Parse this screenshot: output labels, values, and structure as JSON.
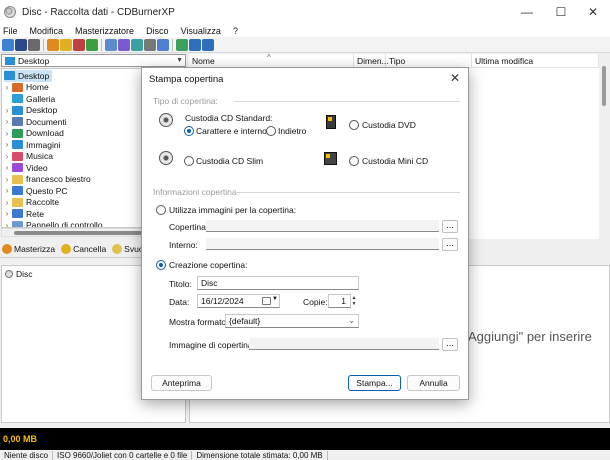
{
  "window": {
    "title": "Disc - Raccolta dati - CDBurnerXP"
  },
  "menu": [
    "File",
    "Modifica",
    "Masterizzatore",
    "Disco",
    "Visualizza",
    "?"
  ],
  "toolbar_icons": [
    {
      "name": "new-icon",
      "color": "#3d7fd0"
    },
    {
      "name": "save-icon",
      "color": "#2b4a8c"
    },
    {
      "name": "print-icon",
      "color": "#6a6a6a"
    },
    {
      "name": "burn-icon",
      "color": "#e08a1e"
    },
    {
      "name": "erase-icon",
      "color": "#e0b01e"
    },
    {
      "name": "disc-icon",
      "color": "#c04040"
    },
    {
      "name": "refresh-icon",
      "color": "#3ca040"
    },
    {
      "name": "cd-drive-icon",
      "color": "#5a8ad0"
    },
    {
      "name": "dvd-drive-icon",
      "color": "#7a5ad0"
    },
    {
      "name": "audio-icon",
      "color": "#3ca0a0"
    },
    {
      "name": "options-icon",
      "color": "#777777"
    },
    {
      "name": "settings-icon",
      "color": "#4f7fd0"
    },
    {
      "name": "world-icon",
      "color": "#3aa060"
    },
    {
      "name": "help-icon",
      "color": "#2d6fb8"
    },
    {
      "name": "info-icon",
      "color": "#2d6fb8"
    }
  ],
  "address": {
    "value": "Desktop"
  },
  "tree": [
    {
      "label": "Desktop",
      "icon": "desktop-icon",
      "color": "#2b8fd6",
      "selected": true,
      "expander": ""
    },
    {
      "label": "Home",
      "icon": "home-icon",
      "color": "#d6692b",
      "expander": "›"
    },
    {
      "label": "Galleria",
      "icon": "gallery-icon",
      "color": "#2b9fd6",
      "expander": ""
    },
    {
      "label": "Desktop",
      "icon": "desktop-icon",
      "color": "#2b8fd6",
      "expander": "›"
    },
    {
      "label": "Documenti",
      "icon": "documents-icon",
      "color": "#5a7ab0",
      "expander": "›"
    },
    {
      "label": "Download",
      "icon": "download-icon",
      "color": "#2b9f5a",
      "expander": "›"
    },
    {
      "label": "Immagini",
      "icon": "pictures-icon",
      "color": "#2b8fd6",
      "expander": "›"
    },
    {
      "label": "Musica",
      "icon": "music-icon",
      "color": "#d64a6a",
      "expander": "›"
    },
    {
      "label": "Video",
      "icon": "video-icon",
      "color": "#9a4ad6",
      "expander": "›"
    },
    {
      "label": "francesco biestro",
      "icon": "folder-icon",
      "color": "#e8c050",
      "expander": "›"
    },
    {
      "label": "Questo PC",
      "icon": "pc-icon",
      "color": "#3a7ad0",
      "expander": "›"
    },
    {
      "label": "Raccolte",
      "icon": "libraries-icon",
      "color": "#e8c050",
      "expander": "›"
    },
    {
      "label": "Rete",
      "icon": "network-icon",
      "color": "#3a7ad0",
      "expander": "›"
    },
    {
      "label": "Pannello di controllo",
      "icon": "control-panel-icon",
      "color": "#6a9ad0",
      "expander": "›"
    }
  ],
  "filelist": {
    "columns": [
      "Nome",
      "Dimen...",
      "Tipo",
      "Ultima modifica"
    ],
    "sort_indicator": "^"
  },
  "actions": [
    {
      "label": "Masterizza",
      "icon": "burn-icon",
      "color": "#e08a1e"
    },
    {
      "label": "Cancella",
      "icon": "erase-icon",
      "color": "#e0b01e"
    },
    {
      "label": "Svuot",
      "icon": "clear-icon",
      "color": "#e0c050"
    }
  ],
  "disc": {
    "label": "Disc"
  },
  "hint": "Aggiungi\" per inserire",
  "capacity": "0,00 MB",
  "status": [
    "Niente disco",
    "ISO 9660/Joliet con 0 cartelle e 0 file",
    "Dimensione totale stimata: 0,00 MB"
  ],
  "dialog": {
    "title": "Stampa copertina",
    "close": "✕",
    "section1": "Tipo di copertina:",
    "standard_label": "Custodia CD Standard:",
    "front": "Carattere e interno",
    "back": "Indietro",
    "dvd": "Custodia DVD",
    "slim": "Custodia CD Slim",
    "mini": "Custodia Mini CD",
    "section2": "Informazioni copertina",
    "use_images": "Utilizza immagini per la copertina:",
    "cover_label": "Copertina:",
    "inner_label": "Interno:",
    "dots": "...",
    "create": "Creazione copertina:",
    "title_label": "Titolo:",
    "title_value": "Disc",
    "date_label": "Data:",
    "date_value": "16/12/2024",
    "copies_label": "Copie:",
    "copies_value": "1",
    "format_label": "Mostra formato:",
    "format_value": "{default}",
    "image_label": "Immagine di copertina:",
    "preview": "Anteprima",
    "print": "Stampa...",
    "cancel": "Annulla"
  }
}
